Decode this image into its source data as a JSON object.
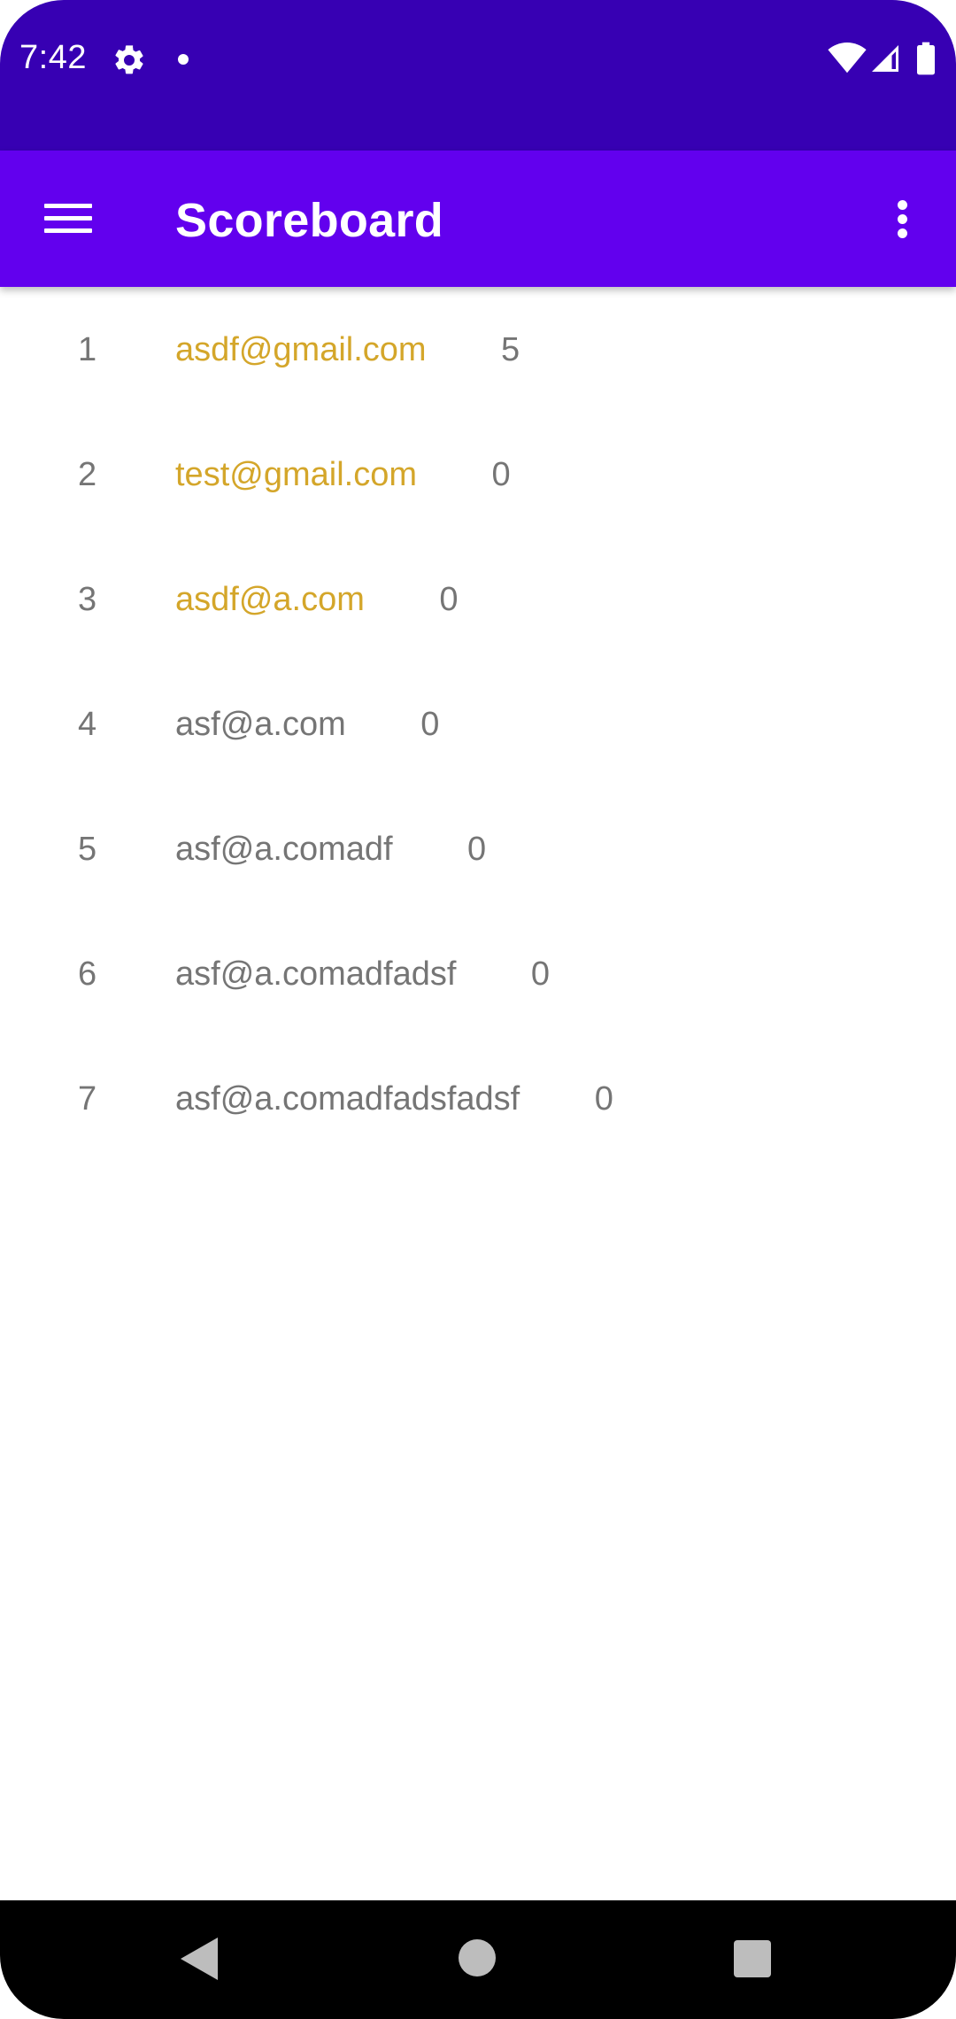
{
  "status_bar": {
    "time": "7:42",
    "icons": [
      "gear-icon",
      "notification-dot",
      "wifi-icon",
      "signal-icon",
      "battery-icon"
    ]
  },
  "app_bar": {
    "title": "Scoreboard",
    "menu_icon": "hamburger-menu-icon",
    "overflow_icon": "more-vertical-icon",
    "color": "#6200EE"
  },
  "colors": {
    "status_bar": "#3700B3",
    "highlight_text": "#D4A62A",
    "normal_text": "#757575"
  },
  "scoreboard": {
    "rows": [
      {
        "rank": "1",
        "email": "asdf@gmail.com",
        "score": "5",
        "highlight": true
      },
      {
        "rank": "2",
        "email": "test@gmail.com",
        "score": "0",
        "highlight": true
      },
      {
        "rank": "3",
        "email": "asdf@a.com",
        "score": "0",
        "highlight": true
      },
      {
        "rank": "4",
        "email": "asf@a.com",
        "score": "0",
        "highlight": false
      },
      {
        "rank": "5",
        "email": "asf@a.comadf",
        "score": "0",
        "highlight": false
      },
      {
        "rank": "6",
        "email": "asf@a.comadfadsf",
        "score": "0",
        "highlight": false
      },
      {
        "rank": "7",
        "email": "asf@a.comadfadsfadsf",
        "score": "0",
        "highlight": false
      }
    ]
  },
  "nav_bar": {
    "buttons": [
      "back-icon",
      "home-icon",
      "recents-icon"
    ]
  }
}
